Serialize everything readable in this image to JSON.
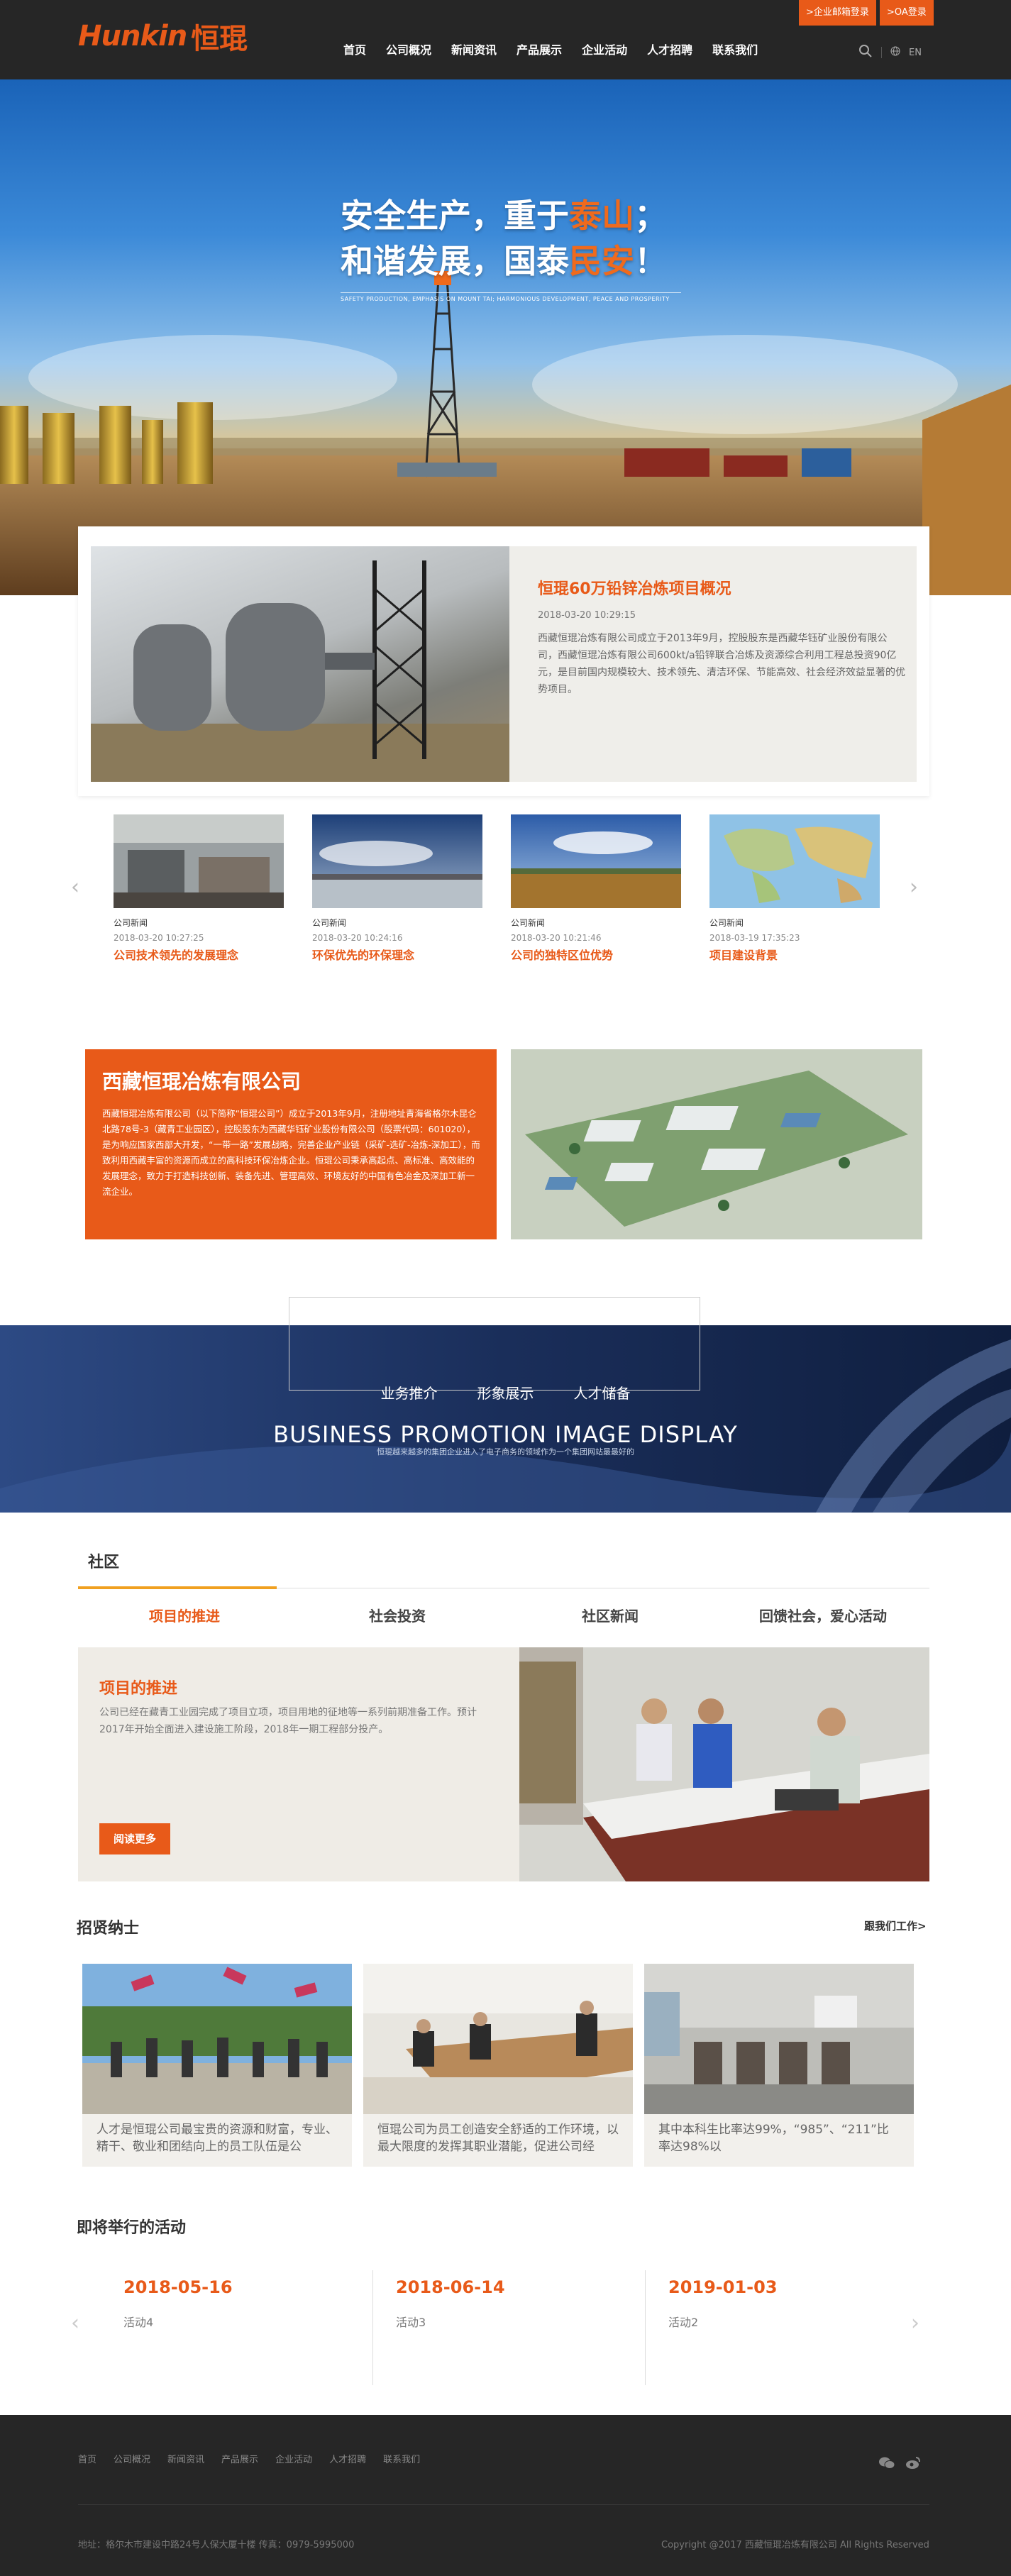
{
  "header": {
    "logo_en": "Hunkin",
    "logo_cn": "恒琨",
    "nav": [
      "首页",
      "公司概况",
      "新闻资讯",
      "产品展示",
      "企业活动",
      "人才招聘",
      "联系我们"
    ],
    "top_buttons": [
      ">企业邮箱登录",
      ">OA登录"
    ],
    "lang": "EN"
  },
  "hero": {
    "line1_a": "安全生产，重于",
    "line1_hl": "泰山",
    "line1_b": "；",
    "line2_a": "和谐发展，国泰",
    "line2_hl": "民安",
    "line2_b": "！",
    "subline": "SAFETY PRODUCTION, EMPHASIS ON MOUNT TAI; HARMONIOUS DEVELOPMENT, PEACE AND PROSPERITY"
  },
  "intro": {
    "title": "恒琨60万铅锌冶炼项目概况",
    "date": "2018-03-20 10:29:15",
    "desc": "西藏恒琨冶炼有限公司成立于2013年9月，控股股东是西藏华钰矿业股份有限公司，西藏恒琨冶炼有限公司600kt/a铅锌联合冶炼及资源综合利用工程总投资90亿元，是目前国内规模较大、技术领先、清洁环保、节能高效、社会经济效益显著的优势项目。"
  },
  "news": [
    {
      "cat": "公司新闻",
      "date": "2018-03-20 10:27:25",
      "title": "公司技术领先的发展理念"
    },
    {
      "cat": "公司新闻",
      "date": "2018-03-20 10:24:16",
      "title": "环保优先的环保理念"
    },
    {
      "cat": "公司新闻",
      "date": "2018-03-20 10:21:46",
      "title": "公司的独特区位优势"
    },
    {
      "cat": "公司新闻",
      "date": "2018-03-19 17:35:23",
      "title": "项目建设背景"
    }
  ],
  "company": {
    "name": "西藏恒琨冶炼有限公司",
    "desc": "西藏恒琨冶炼有限公司（以下简称“恒琨公司”）成立于2013年9月，注册地址青海省格尔木昆仑北路78号-3（藏青工业园区），控股股东为西藏华钰矿业股份有限公司（股票代码：601020），是为响应国家西部大开发，“一带一路”发展战略，完善企业产业链（采矿-选矿-冶炼-深加工），而致利用西藏丰富的资源而成立的高科技环保冶炼企业。恒琨公司秉承高起点、高标准、高效能的发展理念，致力于打造科技创新、装备先进、管理高效、环境友好的中国有色冶金及深加工新一流企业。"
  },
  "business": {
    "nav": [
      "业务推介",
      "形象展示",
      "人才储备"
    ],
    "title": "BUSINESS PROMOTION IMAGE DISPLAY",
    "sub": "恒琨越来越多的集团企业进入了电子商务的领域作为一个集团网站最最好的"
  },
  "community": {
    "heading": "社区",
    "tabs": [
      "项目的推进",
      "社会投资",
      "社区新闻",
      "回馈社会，爱心活动"
    ],
    "title": "项目的推进",
    "desc": "公司已经在藏青工业园完成了项目立项，项目用地的征地等一系列前期准备工作。预计2017年开始全面进入建设施工阶段，2018年一期工程部分投产。",
    "btn": "阅读更多"
  },
  "recruit": {
    "heading": "招贤纳士",
    "more": "跟我们工作>",
    "cards": [
      "人才是恒琨公司最宝贵的资源和财富，专业、精干、敬业和团结向上的员工队伍是公",
      "恒琨公司为员工创造安全舒适的工作环境，以最大限度的发挥其职业潜能，促进公司经",
      "其中本科生比率达99%，“985”、“211”比率达98%以"
    ]
  },
  "events": {
    "heading": "即将举行的活动",
    "items": [
      {
        "date": "2018-05-16",
        "name": "活动4"
      },
      {
        "date": "2018-06-14",
        "name": "活动3"
      },
      {
        "date": "2019-01-03",
        "name": "活动2"
      }
    ]
  },
  "footer": {
    "nav": [
      "首页",
      "公司概况",
      "新闻资讯",
      "产品展示",
      "企业活动",
      "人才招聘",
      "联系我们"
    ],
    "address": "地址：格尔木市建设中路24号人保大厦十楼  传真：0979-5995000",
    "copyright": "Copyright @2017 西藏恒琨冶炼有限公司 All Rights Reserved"
  },
  "colors": {
    "accent": "#e85a19",
    "dark": "#262626"
  }
}
